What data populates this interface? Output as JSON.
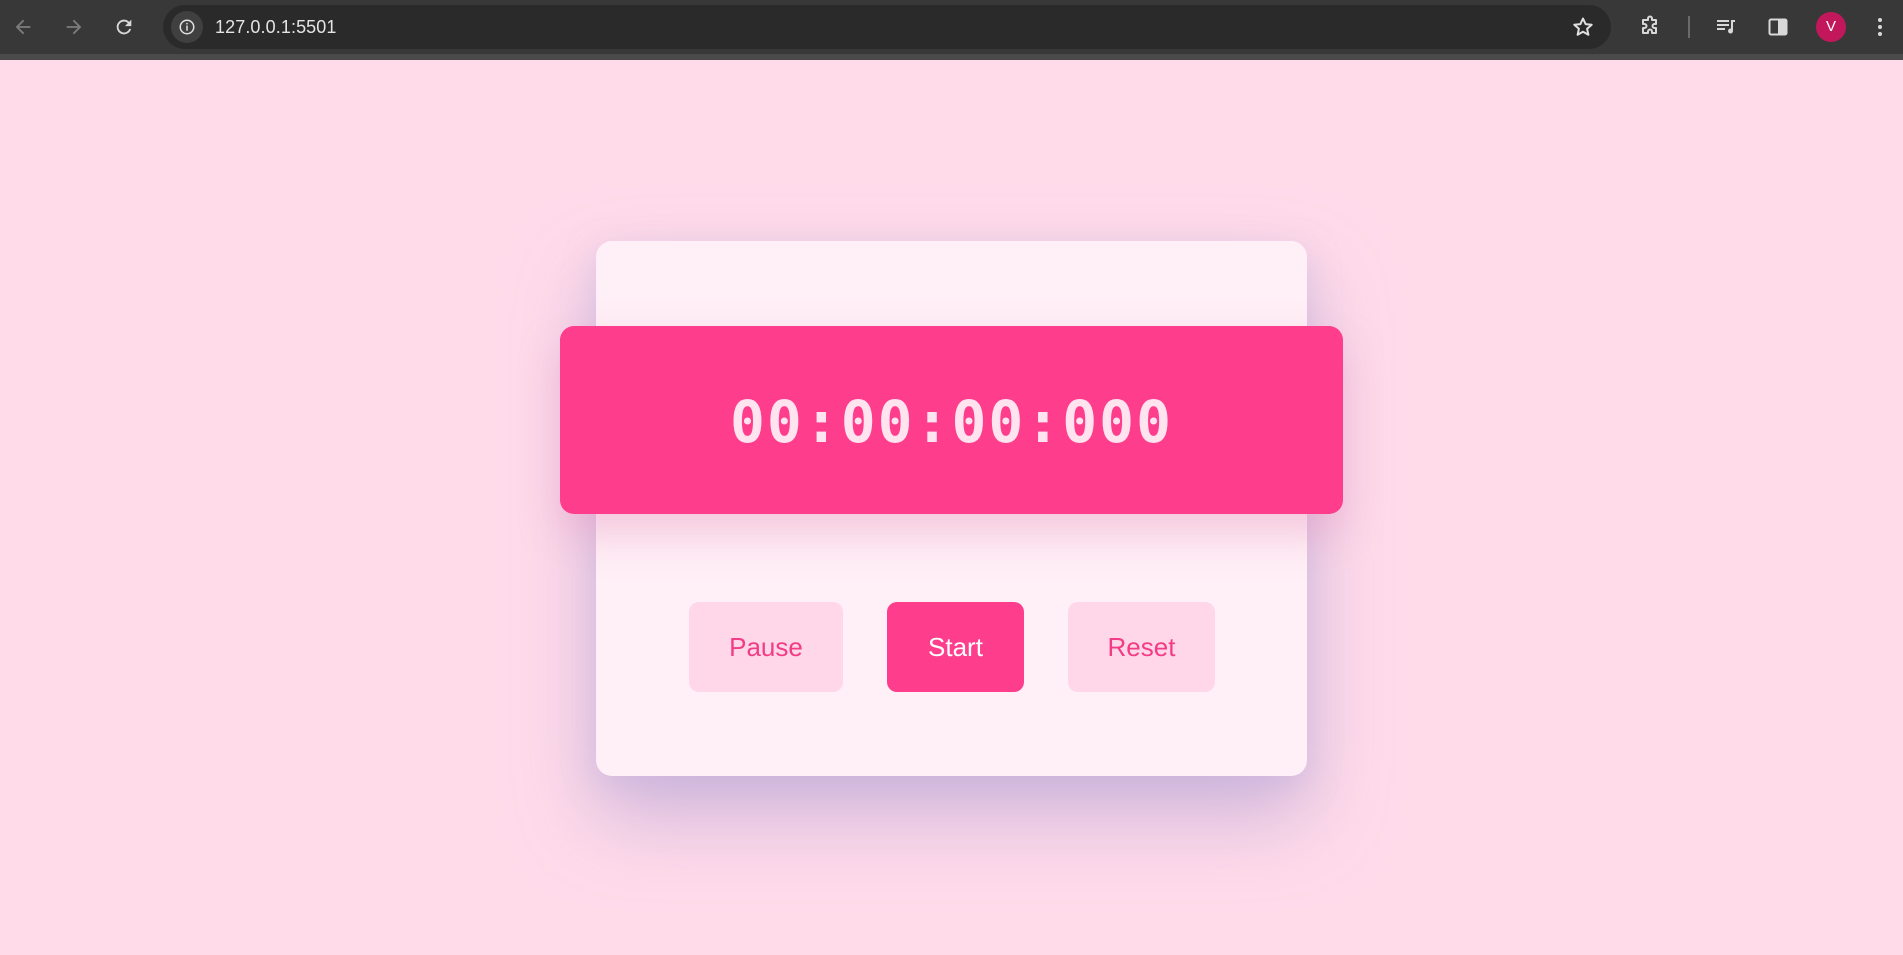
{
  "browser": {
    "url": "127.0.0.1:5501",
    "profile_initial": "V",
    "icons": {
      "back": "arrow-left-icon",
      "forward": "arrow-right-icon",
      "reload": "reload-icon",
      "site_info": "info-icon",
      "bookmark": "star-icon",
      "extensions": "puzzle-icon",
      "media": "playlist-icon",
      "side_panel": "side-panel-icon",
      "menu": "kebab-menu-icon"
    }
  },
  "stopwatch": {
    "display_time": "00:00:00:000",
    "buttons": {
      "pause": "Pause",
      "start": "Start",
      "reset": "Reset"
    }
  },
  "colors": {
    "page_background": "#ffdbea",
    "card_background": "#ffeff6",
    "accent": "#ff3d8d",
    "secondary_button": "#ffd7e8",
    "avatar": "#c2185b"
  }
}
